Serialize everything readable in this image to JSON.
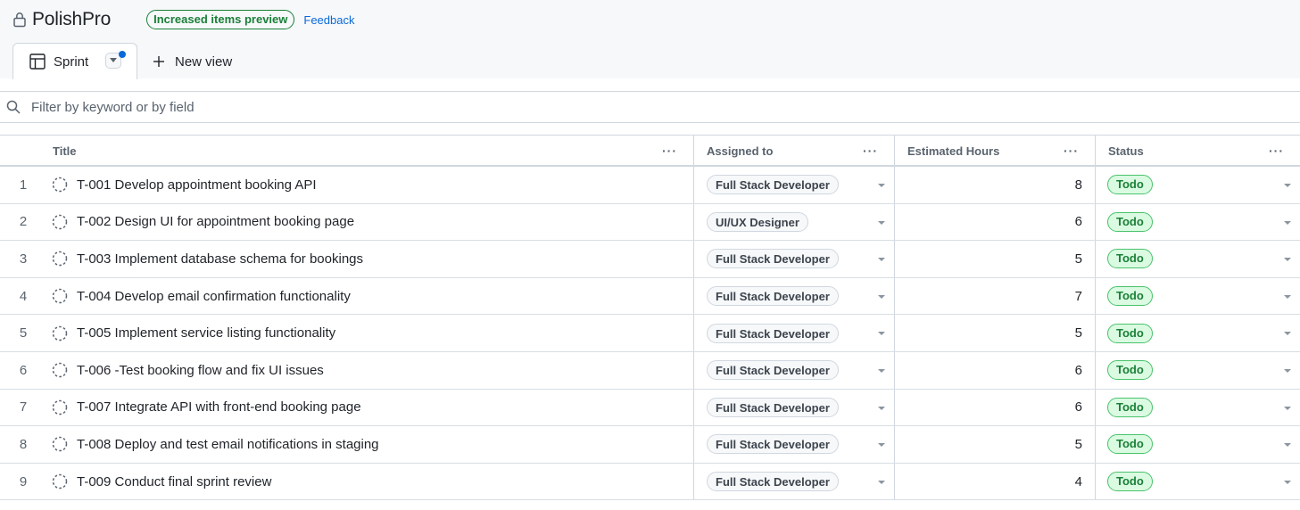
{
  "header": {
    "project_title": "PolishPro",
    "preview_badge": "Increased items preview",
    "feedback_label": "Feedback"
  },
  "views": {
    "active_tab": "Sprint",
    "new_view_label": "New view"
  },
  "filter": {
    "placeholder": "Filter by keyword or by field",
    "value": ""
  },
  "table": {
    "columns": {
      "title": "Title",
      "assigned": "Assigned to",
      "hours": "Estimated Hours",
      "status": "Status"
    },
    "column_menu_glyph": "···",
    "rows": [
      {
        "num": "1",
        "title": "T-001 Develop appointment booking API",
        "assigned": "Full Stack Developer",
        "hours": "8",
        "status": "Todo"
      },
      {
        "num": "2",
        "title": "T-002 Design UI for appointment booking page",
        "assigned": "UI/UX Designer",
        "hours": "6",
        "status": "Todo"
      },
      {
        "num": "3",
        "title": "T-003 Implement database schema for bookings",
        "assigned": "Full Stack Developer",
        "hours": "5",
        "status": "Todo"
      },
      {
        "num": "4",
        "title": "T-004 Develop email confirmation functionality",
        "assigned": "Full Stack Developer",
        "hours": "7",
        "status": "Todo"
      },
      {
        "num": "5",
        "title": "T-005 Implement service listing functionality",
        "assigned": "Full Stack Developer",
        "hours": "5",
        "status": "Todo"
      },
      {
        "num": "6",
        "title": "T-006 -Test booking flow and fix UI issues",
        "assigned": "Full Stack Developer",
        "hours": "6",
        "status": "Todo"
      },
      {
        "num": "7",
        "title": "T-007 Integrate API with front-end booking page",
        "assigned": "Full Stack Developer",
        "hours": "6",
        "status": "Todo"
      },
      {
        "num": "8",
        "title": "T-008 Deploy and test email notifications in staging",
        "assigned": "Full Stack Developer",
        "hours": "5",
        "status": "Todo"
      },
      {
        "num": "9",
        "title": "T-009 Conduct final sprint review",
        "assigned": "Full Stack Developer",
        "hours": "4",
        "status": "Todo"
      }
    ]
  },
  "icons": {
    "visibility": "lock-icon",
    "view": "table-icon",
    "add": "plus-icon",
    "search": "search-icon",
    "item": "draft-issue-icon",
    "dropdown": "chevron-down-icon"
  },
  "colors": {
    "accent": "#0969da",
    "success": "#1a7f37",
    "status_bg": "#dafbe1",
    "border": "#d0d7de"
  }
}
